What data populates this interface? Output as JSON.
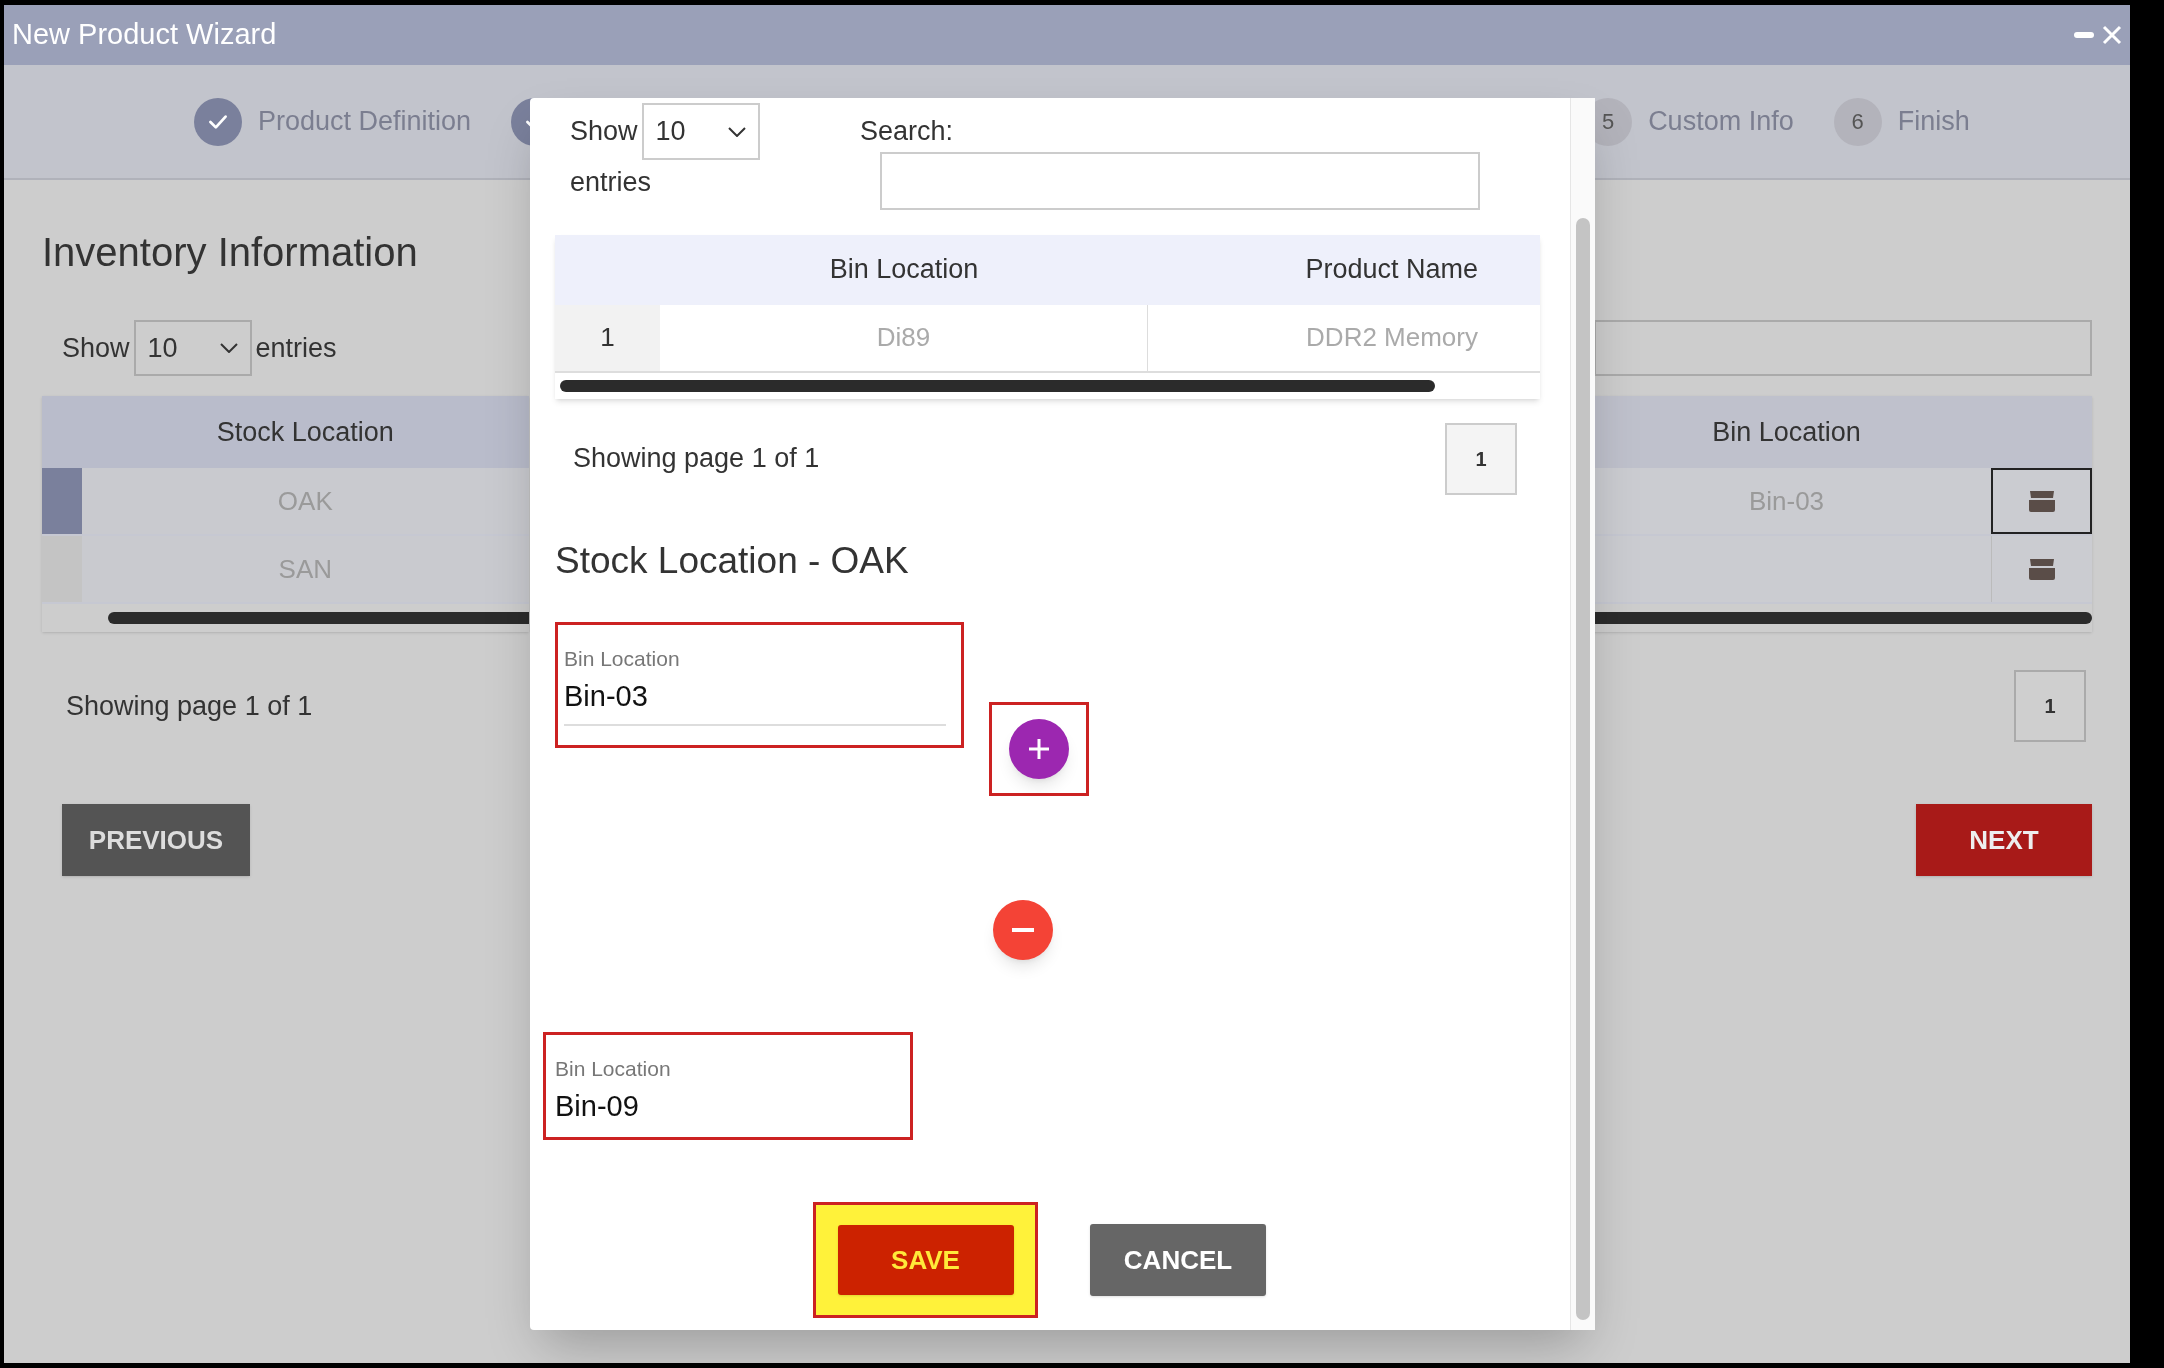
{
  "window": {
    "title": "New Product Wizard"
  },
  "steps": [
    {
      "label": "Product Definition",
      "done": true
    },
    {
      "done": true
    },
    {
      "number": "5",
      "label": "Custom Info",
      "done": false
    },
    {
      "number": "6",
      "label": "Finish",
      "done": false
    }
  ],
  "page": {
    "heading": "Inventory Information",
    "show_label": "Show",
    "page_size": "10",
    "entries_label": "entries",
    "table": {
      "columns": [
        "Stock Location",
        "Bin Location"
      ],
      "rows": [
        {
          "stock_location": "OAK",
          "bin_location": "Bin-03",
          "selected": true
        },
        {
          "stock_location": "SAN",
          "selected": false
        }
      ]
    },
    "pagination_info": "Showing page 1 of 1",
    "current_page": "1",
    "previous": "PREVIOUS",
    "next": "NEXT"
  },
  "dialog": {
    "show_label": "Show",
    "page_size": "10",
    "entries_label": "entries",
    "search_label": "Search:",
    "table": {
      "columns": [
        "Bin Location",
        "Product Name"
      ],
      "rows": [
        {
          "index": "1",
          "bin_location": "Di89",
          "product_name": "DDR2 Memory"
        }
      ]
    },
    "pagination_info": "Showing page 1 of 1",
    "current_page": "1",
    "section_title": "Stock Location - OAK",
    "fields": [
      {
        "label": "Bin Location",
        "value": "Bin-03",
        "annotated": true
      },
      {
        "label": "Bin Location",
        "value": "Bin-09",
        "annotated": true
      }
    ],
    "add_annotated": true,
    "save": {
      "label": "SAVE",
      "annotated": true
    },
    "cancel": {
      "label": "CANCEL"
    }
  }
}
